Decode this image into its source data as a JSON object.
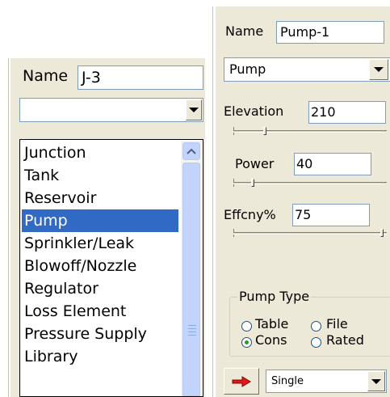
{
  "left_panel": {
    "name_label": "Name",
    "name_value": "J-3",
    "type_select_value": "",
    "type_list": [
      "Junction",
      "Tank",
      "Reservoir",
      "Pump",
      "Sprinkler/Leak",
      "Blowoff/Nozzle",
      "Regulator",
      "Loss Element",
      "Pressure Supply",
      "Library"
    ],
    "selected_item": "Pump"
  },
  "right_panel": {
    "name_label": "Name",
    "name_value": "Pump-1",
    "type_select_value": "Pump",
    "elevation_label": "Elevation",
    "elevation_value": "210",
    "power_label": "Power",
    "power_value": "40",
    "efficiency_label": "Effcny%",
    "efficiency_value": "75",
    "slider_levels": {
      "elevation": 0.2,
      "power": 0.12,
      "efficiency": 0.98
    },
    "pump_type": {
      "title": "Pump Type",
      "options": [
        {
          "label": "Table",
          "selected": false
        },
        {
          "label": "File",
          "selected": false
        },
        {
          "label": "Cons",
          "selected": true
        },
        {
          "label": "Rated",
          "selected": false
        }
      ]
    },
    "mode_select_value": "Single"
  },
  "colors": {
    "selection": "#316ac5",
    "panel": "#ece9d8",
    "arrow": "#e01818"
  }
}
